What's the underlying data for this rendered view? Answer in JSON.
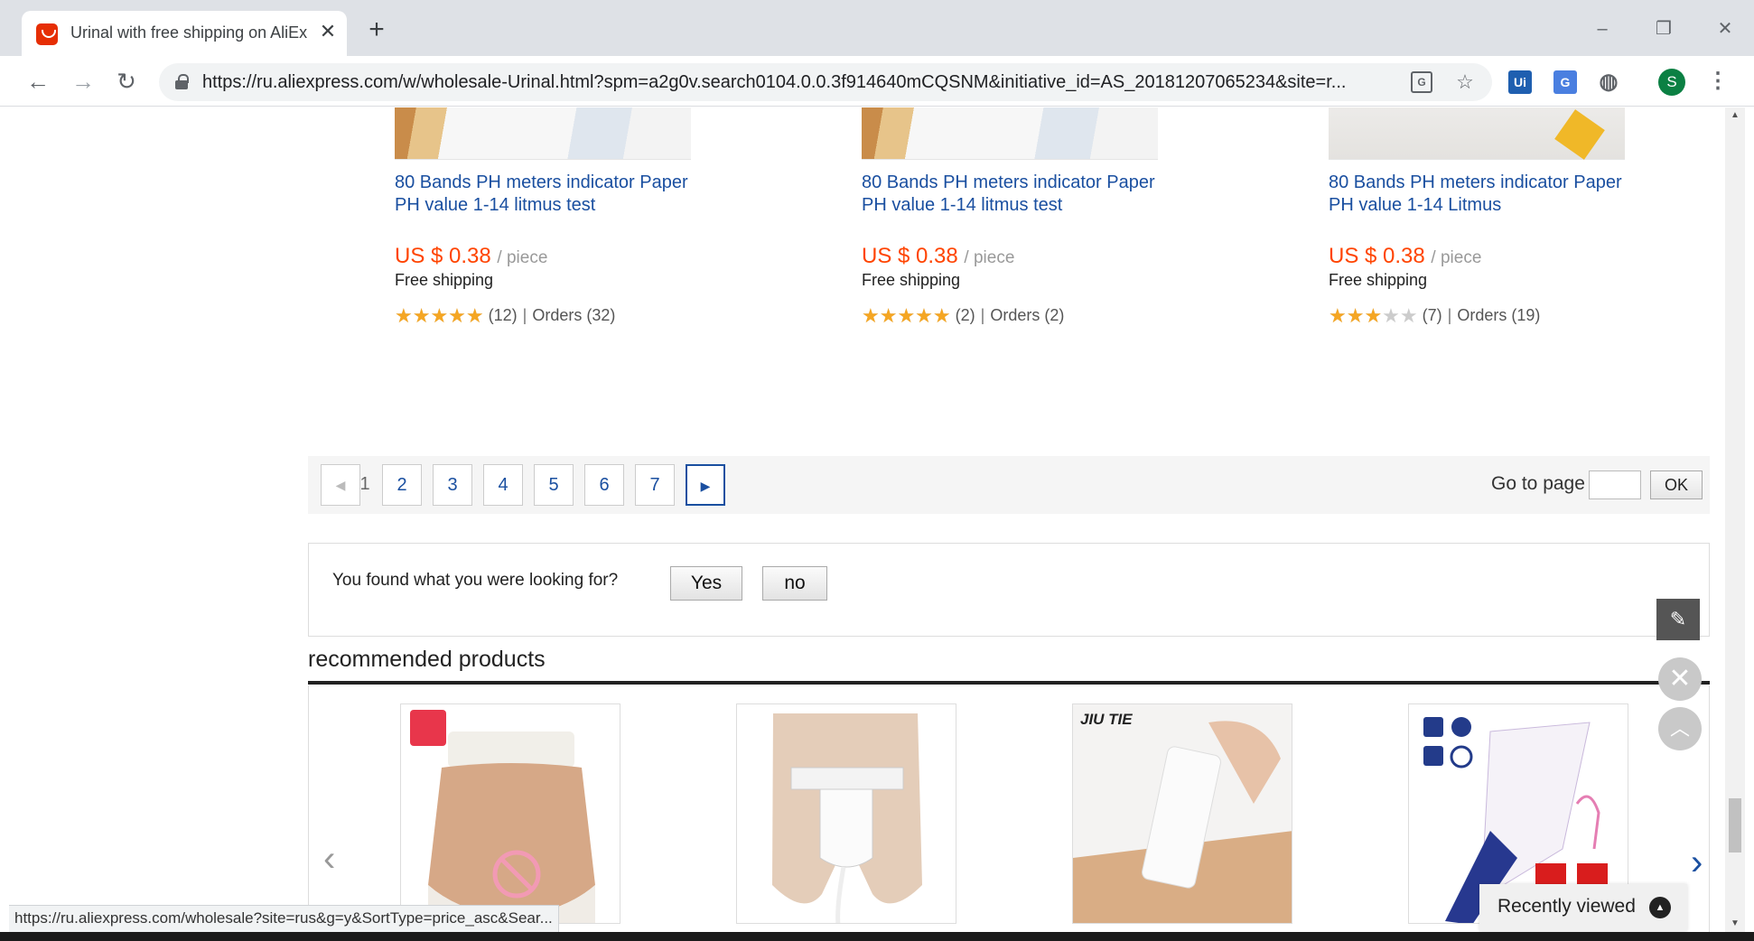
{
  "browser": {
    "tab_title": "Urinal with free shipping on AliExpress",
    "tab_close": "✕",
    "new_tab": "+",
    "url": "https://ru.aliexpress.com/w/wholesale-Urinal.html?spm=a2g0v.search0104.0.0.3f914640mCQSNM&initiative_id=AS_20181207065234&site=r...",
    "window_controls": [
      "–",
      "❐",
      "✕"
    ],
    "extensions": [
      {
        "label": "Ui",
        "color": "#1f5fb0"
      },
      {
        "label": "G",
        "color": "#4a7fe0"
      },
      {
        "label": "◍",
        "color": "#9aa0a6"
      }
    ],
    "profile_initial": "S",
    "status_url": "https://ru.aliexpress.com/wholesale?site=rus&g=y&SortType=price_asc&Sear..."
  },
  "products": [
    {
      "title": "80 Bands PH meters indicator Paper PH value 1-14 litmus test",
      "price": "US $ 0.38",
      "unit": "/ piece",
      "shipping": "Free shipping",
      "rating": 5,
      "reviews": "(12)",
      "orders": "Orders (32)"
    },
    {
      "title": "80 Bands PH meters indicator Paper PH value 1-14 litmus test",
      "price": "US $ 0.38",
      "unit": "/ piece",
      "shipping": "Free shipping",
      "rating": 5,
      "reviews": "(2)",
      "orders": "Orders (2)"
    },
    {
      "title": "80 Bands PH meters indicator Paper PH value 1-14 Litmus",
      "price": "US $ 0.38",
      "unit": "/ piece",
      "shipping": "Free shipping",
      "rating": 3,
      "reviews": "(7)",
      "orders": "Orders (19)"
    }
  ],
  "pagination": {
    "current": "1",
    "pages": [
      "2",
      "3",
      "4",
      "5",
      "6",
      "7"
    ],
    "goto_label": "Go to page",
    "ok_label": "OK"
  },
  "feedback": {
    "question": "You found what you were looking for?",
    "yes": "Yes",
    "no": "no"
  },
  "recommended": {
    "title": "recommended products",
    "item3_brand": "JIU TIE",
    "recently_viewed": "Recently viewed"
  },
  "colors": {
    "link": "#1a4fa0",
    "price": "#ff4400",
    "star": "#f5a623"
  }
}
